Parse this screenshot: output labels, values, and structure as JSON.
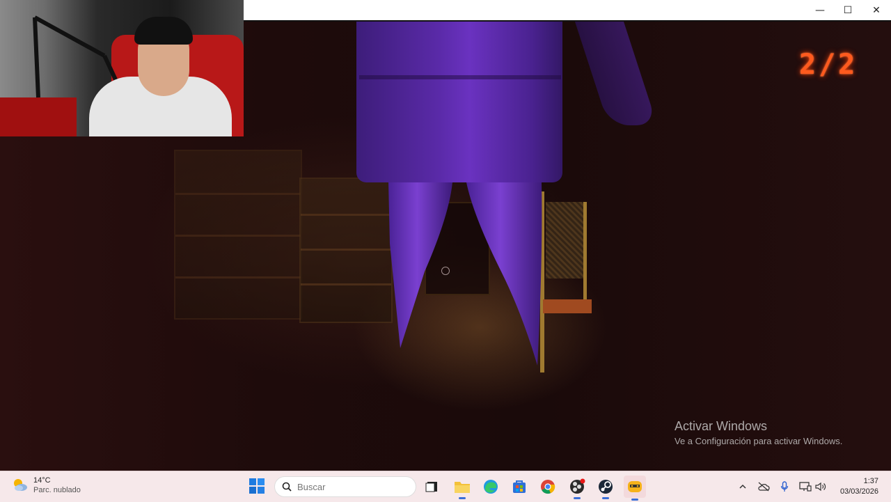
{
  "window": {
    "controls": {
      "minimize": "—",
      "maximize": "☐",
      "close": "✕"
    }
  },
  "game": {
    "counter": "2/2"
  },
  "activation": {
    "title": "Activar Windows",
    "subtitle": "Ve a Configuración para activar Windows."
  },
  "taskbar": {
    "weather": {
      "temp": "14°C",
      "desc": "Parc. nublado",
      "icon": "partly-cloudy-icon"
    },
    "search": {
      "placeholder": "Buscar"
    },
    "apps": [
      "task-view",
      "file-explorer",
      "edge",
      "store",
      "chrome",
      "obs",
      "steam",
      "game"
    ],
    "clock": {
      "time": "1:37",
      "date": "03/03/2026"
    }
  },
  "colors": {
    "taskbar_bg": "#f6e8ea",
    "counter": "#ff5a1e",
    "creature": "#5a2aa8"
  }
}
